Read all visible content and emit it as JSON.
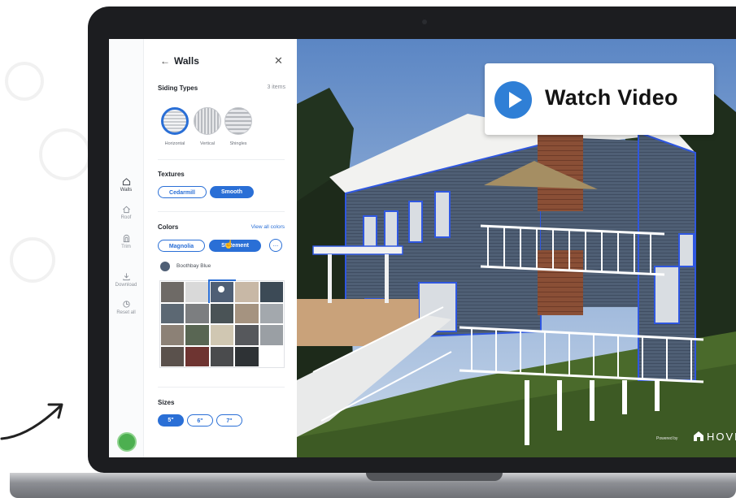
{
  "overlay": {
    "watch_video_label": "Watch Video"
  },
  "brand": {
    "powered_by": "Powered by",
    "name": "HOVER"
  },
  "rail": {
    "items": [
      {
        "label": "Walls",
        "icon": "house-icon",
        "active": true
      },
      {
        "label": "Roof",
        "icon": "roof-icon",
        "active": false
      },
      {
        "label": "Trim",
        "icon": "arch-icon",
        "active": false
      },
      {
        "label": "Download",
        "icon": "download-icon",
        "active": false
      },
      {
        "label": "Reset all",
        "icon": "reset-icon",
        "active": false
      }
    ]
  },
  "panel": {
    "title": "Walls",
    "siding": {
      "title": "Siding Types",
      "count": "3 items",
      "types": [
        "Horizontal",
        "Vertical",
        "Shingles"
      ],
      "selected": "Horizontal"
    },
    "textures": {
      "title": "Textures",
      "options": [
        "Cedarmill",
        "Smooth"
      ],
      "selected": "Smooth"
    },
    "colors": {
      "title": "Colors",
      "view_all": "View all colors",
      "options": [
        "Magnolia",
        "Statement"
      ],
      "selected": "Statement",
      "more": "...",
      "current": "Boothbay Blue",
      "current_hex": "#4f5f75",
      "palette": [
        "#6e6a66",
        "#d9d9d9",
        "#4f5f75",
        "#c8b8a6",
        "#3c4a56",
        "#5c6873",
        "#7c7e80",
        "#4a5356",
        "#a59380",
        "#a3a8ad",
        "#8c8176",
        "#596653",
        "#d0c7b2",
        "#56585c",
        "#9a9fa4",
        "#5a514c",
        "#6e3431",
        "#4a4b4d",
        "#2e3235",
        "#ffffff"
      ]
    },
    "sizes": {
      "title": "Sizes",
      "options": [
        "5\"",
        "6\"",
        "7\""
      ],
      "selected": "5\""
    }
  },
  "colors": {
    "accent": "#2a6fd6",
    "play": "#2f7fd6",
    "siding": "#4f5f75"
  }
}
